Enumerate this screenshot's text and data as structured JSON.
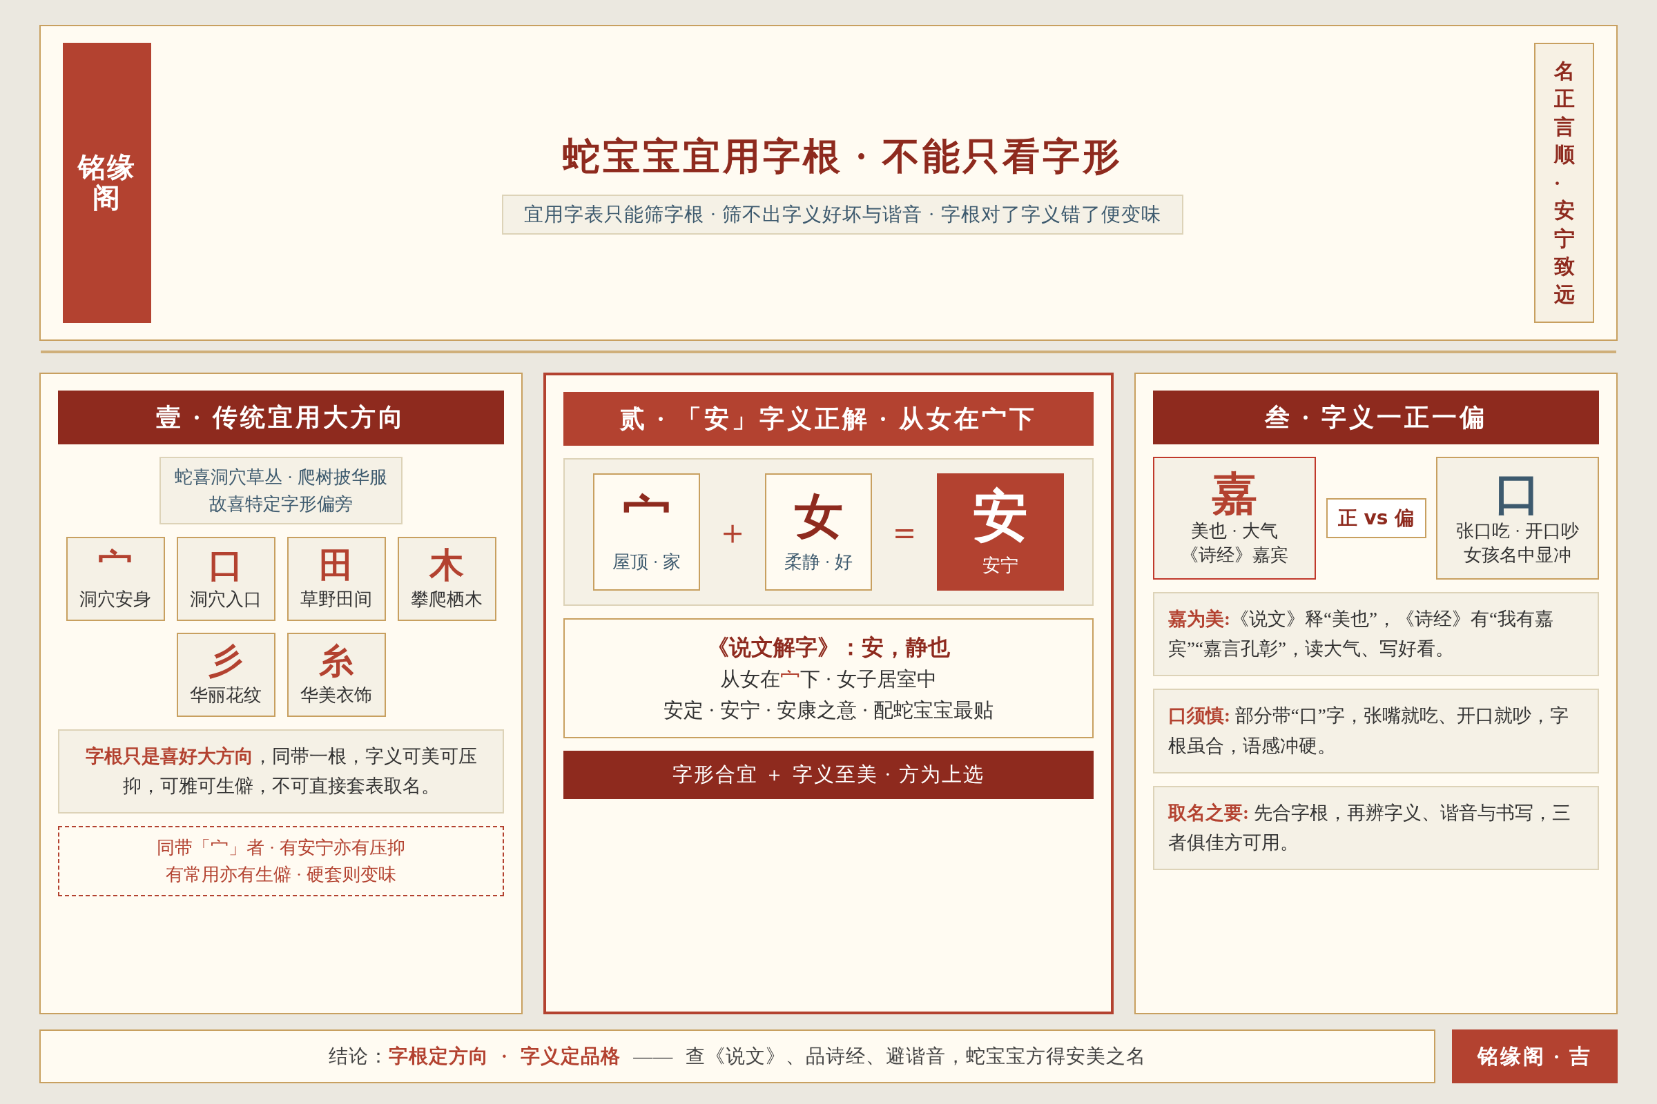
{
  "header": {
    "seal": "铭缘阁",
    "title": "蛇宝宝宜用字根 · 不能只看字形",
    "subtitle": "宜用字表只能筛字根 · 筛不出字义好坏与谐音 · 字根对了字义错了便变味",
    "motto": "名正言顺·安宁致远"
  },
  "columns": [
    {
      "kind": "radicals",
      "heading": "壹 · 传统宜用大方向",
      "note_lines": [
        "蛇喜洞穴草丛 · 爬树披华服",
        "故喜特定字形偏旁"
      ],
      "radicals": [
        {
          "char": "宀",
          "label": "洞穴安身"
        },
        {
          "char": "口",
          "label": "洞穴入口"
        },
        {
          "char": "田",
          "label": "草野田间"
        },
        {
          "char": "木",
          "label": "攀爬栖木"
        },
        {
          "char": "彡",
          "label": "华丽花纹"
        },
        {
          "char": "糸",
          "label": "华美衣饰"
        }
      ],
      "summary": "**字根只是喜好大方向**，同带一根，字义可美可压抑，可雅可生僻，不可直接套表取名。",
      "warning_lines": [
        "同带「宀」者 · 有安宁亦有压抑",
        "有常用亦有生僻 · 硬套则变味"
      ]
    },
    {
      "kind": "equation",
      "heading": "贰 · 「安」字义正解 · 从女在宀下",
      "equation": [
        {
          "kind": "part",
          "char": "宀",
          "label": "屋顶 · 家"
        },
        {
          "kind": "operator",
          "char": "＋"
        },
        {
          "kind": "part",
          "char": "女",
          "label": "柔静 · 好"
        },
        {
          "kind": "operator",
          "char": "＝"
        },
        {
          "kind": "result",
          "char": "安",
          "label": "安宁"
        }
      ],
      "quote_title": "《说文解字》：安，静也",
      "quote_lines": [
        "从女在**宀**下 · 女子居室中",
        "安定 · 安宁 · 安康之意 · 配蛇宝宝最贴"
      ],
      "banner": "字形合宜 ＋ 字义至美 · 方为上选"
    },
    {
      "kind": "compare",
      "heading": "叁 · 字义一正一偏",
      "compare": [
        {
          "kind": "good",
          "char": "嘉",
          "lines": [
            "美也 · 大气",
            "《诗经》嘉宾"
          ]
        },
        {
          "kind": "versus",
          "text": "正 vs 偏"
        },
        {
          "kind": "bad",
          "char": "口",
          "lines": [
            "张口吃 · 开口吵",
            "女孩名中显冲"
          ]
        }
      ],
      "notes": [
        "**嘉为美:**《说文》释“美也”，《诗经》有“我有嘉宾”“嘉言孔彰”，读大气、写好看。",
        "**口须慎:** 部分带“口”字，张嘴就吃、开口就吵，字根虽合，语感冲硬。",
        "**取名之要:** 先合字根，再辨字义、谐音与书写，三者俱佳方可用。"
      ]
    }
  ],
  "footer": {
    "conclusion": "结论：**字根定方向 · 字义定品格** —— 查《说文》、品诗经、避谐音，蛇宝宝方得安美之名",
    "seal": "铭缘阁 · 吉"
  }
}
